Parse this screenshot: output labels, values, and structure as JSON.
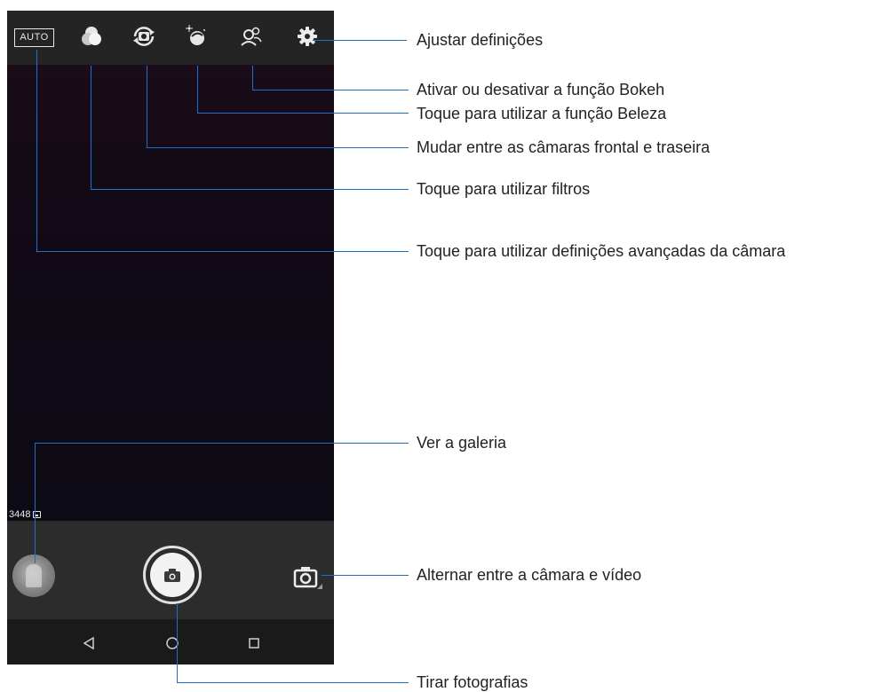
{
  "topbar": {
    "auto_label": "AUTO",
    "icons": [
      "filter-icon",
      "switch-camera-icon",
      "beauty-icon",
      "bokeh-icon",
      "gear-icon"
    ]
  },
  "viewfinder": {
    "photo_count": "3448"
  },
  "navbar": {
    "icons": [
      "back-icon",
      "home-icon",
      "recents-icon"
    ]
  },
  "callouts": {
    "settings": "Ajustar definições",
    "bokeh": "Ativar ou desativar a função Bokeh",
    "beauty": "Toque para utilizar a função Beleza",
    "switch_camera": "Mudar entre as câmaras frontal e traseira",
    "filters": "Toque para utilizar filtros",
    "advanced": "Toque para utilizar definições avançadas da câmara",
    "gallery": "Ver a galeria",
    "mode_switch": "Alternar entre a câmara e vídeo",
    "take_photo": "Tirar fotografias"
  },
  "colors": {
    "callout_line": "#1f6fc8",
    "topbar_bg": "#242424",
    "controlbar_bg": "#2c2c2c",
    "navbar_bg": "#1a1a1a"
  }
}
